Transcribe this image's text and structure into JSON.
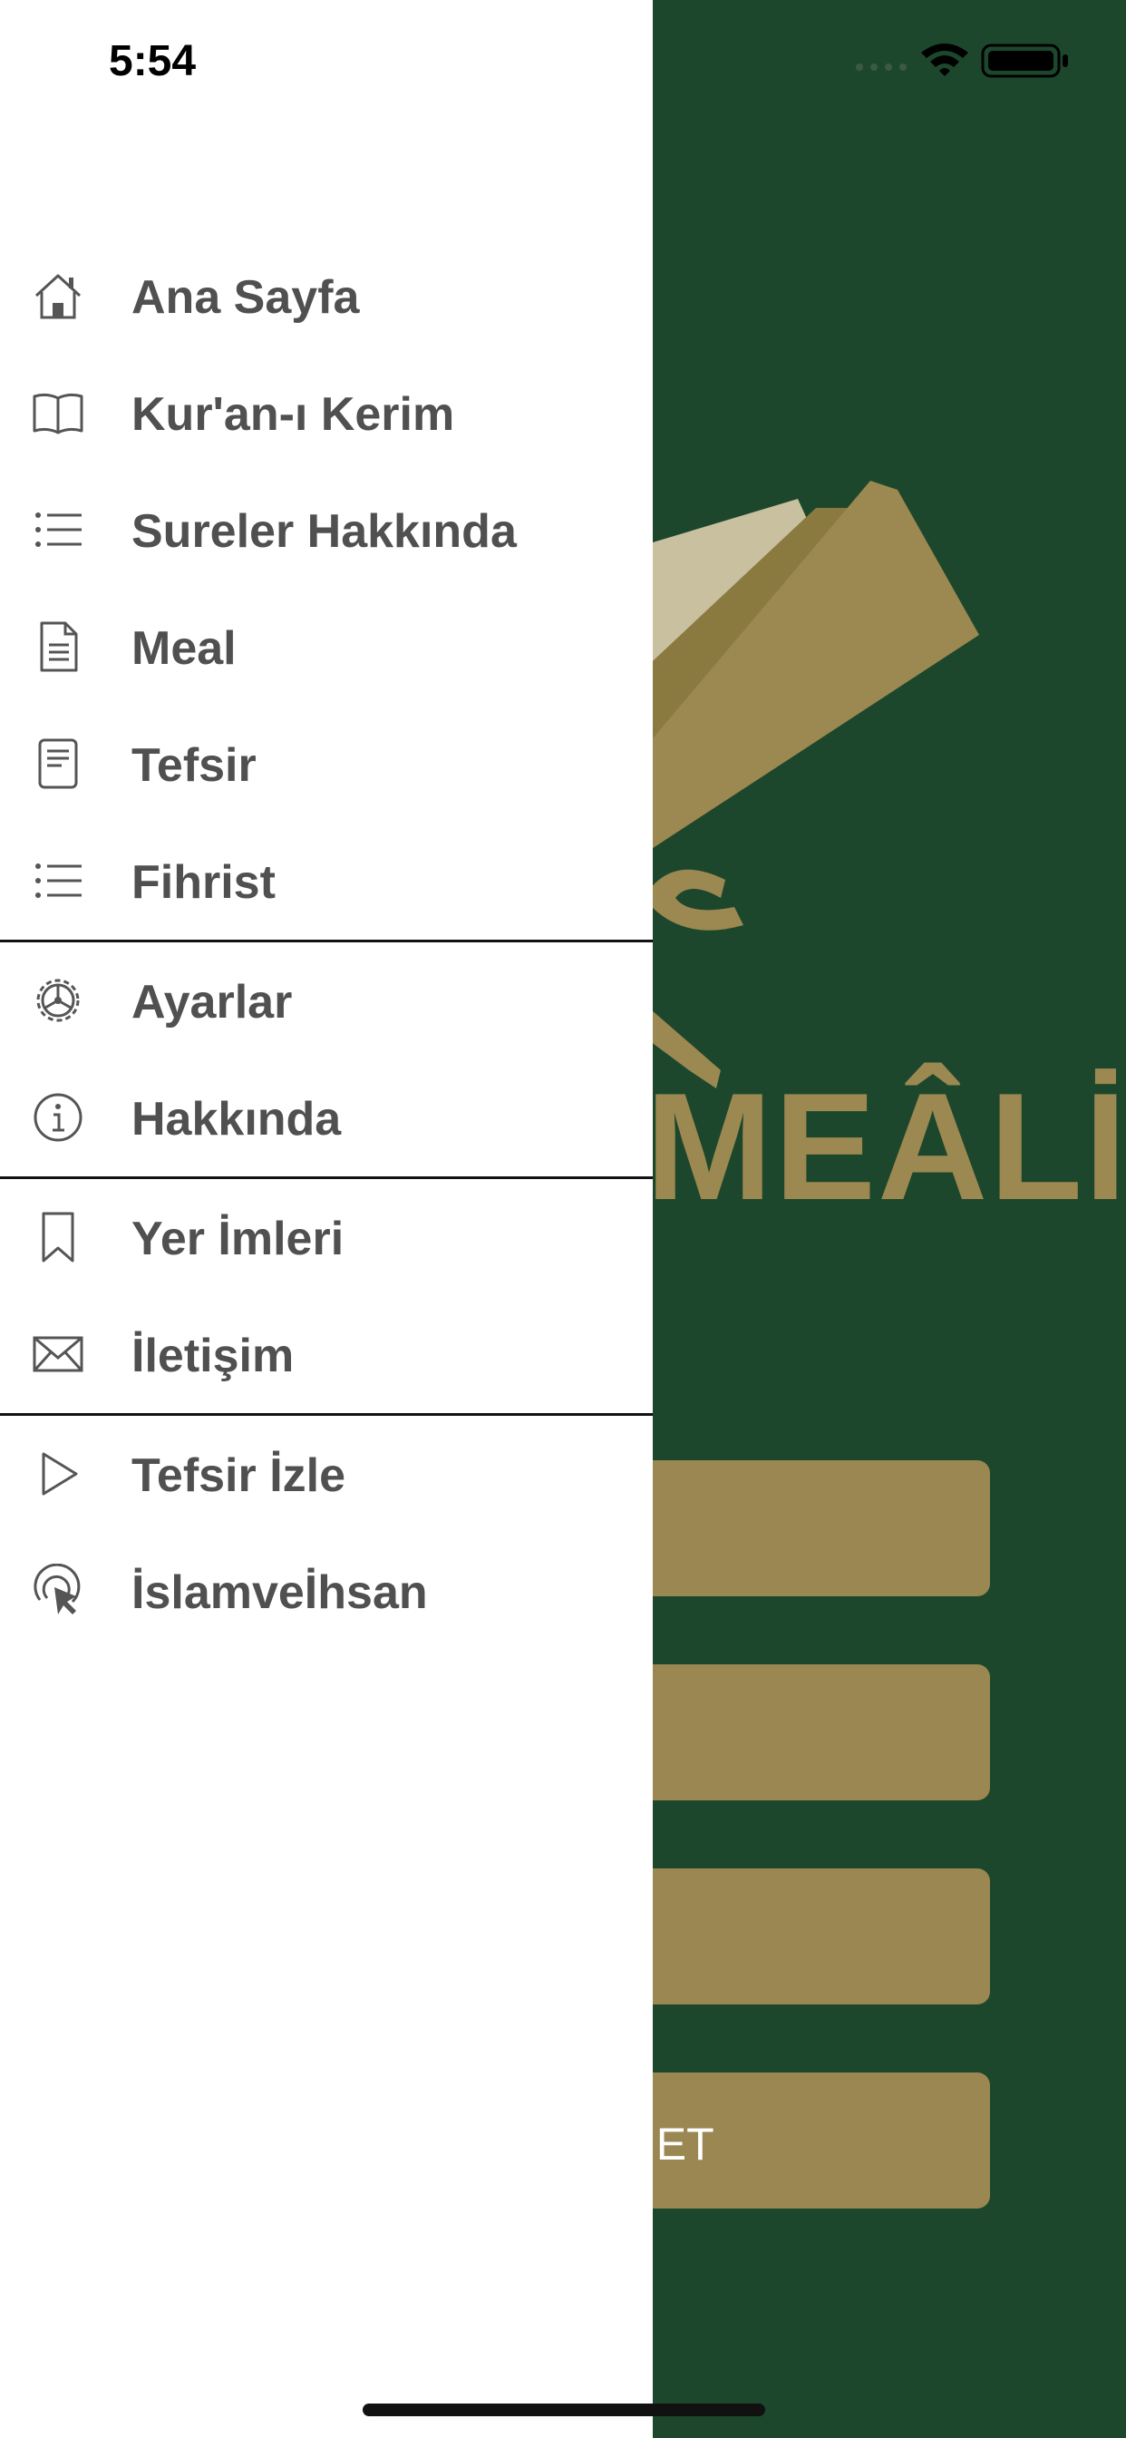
{
  "status_bar": {
    "time": "5:54"
  },
  "drawer": {
    "groups": [
      [
        {
          "label": "Ana Sayfa",
          "icon": "home-icon"
        },
        {
          "label": "Kur'an-ı Kerim",
          "icon": "book-icon"
        },
        {
          "label": "Sureler Hakkında",
          "icon": "list-icon"
        },
        {
          "label": "Meal",
          "icon": "document-icon"
        },
        {
          "label": "Tefsir",
          "icon": "page-icon"
        },
        {
          "label": "Fihrist",
          "icon": "list-icon"
        }
      ],
      [
        {
          "label": "Ayarlar",
          "icon": "gear-icon"
        },
        {
          "label": "Hakkında",
          "icon": "info-icon"
        }
      ],
      [
        {
          "label": "Yer İmleri",
          "icon": "bookmark-icon"
        },
        {
          "label": "İletişim",
          "icon": "mail-icon"
        }
      ],
      [
        {
          "label": "Tefsir İzle",
          "icon": "play-icon"
        },
        {
          "label": "İslamveİhsan",
          "icon": "tap-icon"
        }
      ]
    ]
  },
  "background": {
    "logo_text": "MEÂLİ",
    "buttons": [
      "",
      "",
      "",
      "I ET"
    ]
  },
  "colors": {
    "background_green": "#1d472c",
    "gold": "#9a8752",
    "menu_text": "#505050"
  }
}
